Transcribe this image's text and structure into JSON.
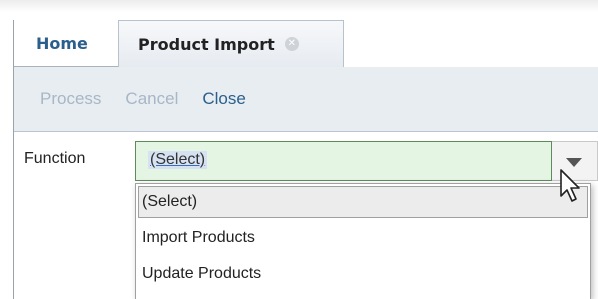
{
  "tabs": [
    {
      "label": "Home"
    },
    {
      "label": "Product Import",
      "close_icon": "close-icon"
    }
  ],
  "toolbar": {
    "process_label": "Process",
    "cancel_label": "Cancel",
    "close_label": "Close"
  },
  "form": {
    "function_label": "Function",
    "function_value": "(Select)",
    "dropdown_icon": "chevron-down-icon"
  },
  "dropdown_options": [
    "(Select)",
    "Import Products",
    "Update Products"
  ],
  "colors": {
    "accent": "#2b5f8c",
    "disabled": "#a8b6c6",
    "toolbar_bg": "#e8edf2",
    "select_bg": "#e5f5e3",
    "select_border": "#5d8c5a"
  }
}
